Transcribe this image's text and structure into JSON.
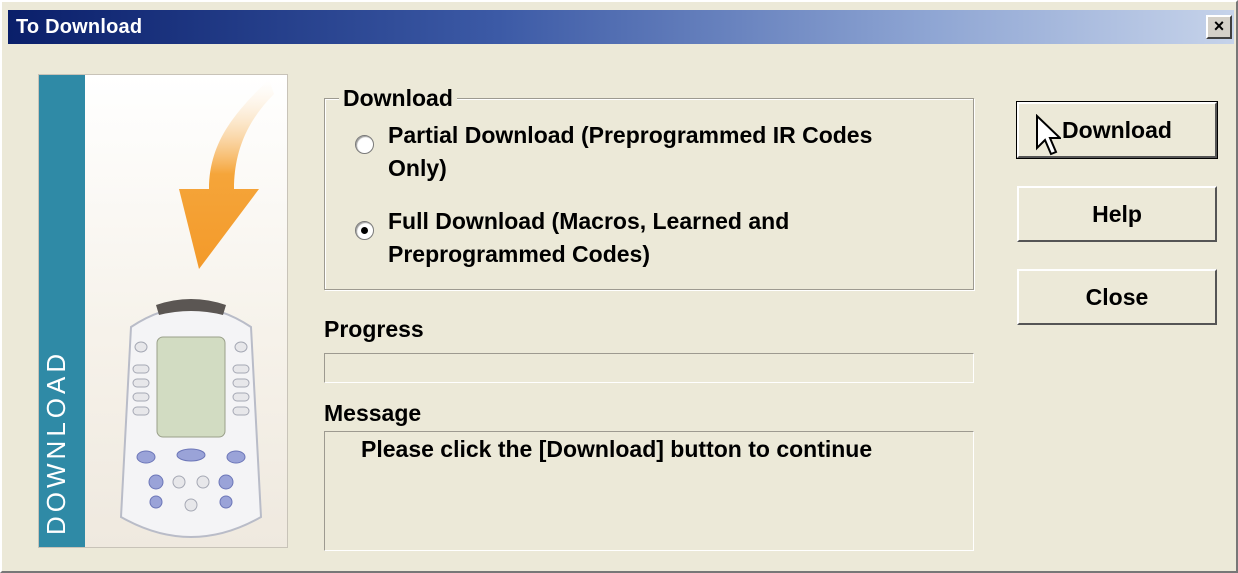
{
  "window": {
    "title": "To Download",
    "close_label": "×"
  },
  "banner": {
    "text": "DOWNLOAD",
    "strip_color": "#2f8aa6",
    "arrow_color": "#f5a53a"
  },
  "download_group": {
    "label": "Download",
    "options": [
      {
        "label": "Partial Download (Preprogrammed IR Codes Only)",
        "checked": false
      },
      {
        "label": "Full Download (Macros, Learned and Preprogrammed Codes)",
        "checked": true
      }
    ]
  },
  "progress": {
    "label": "Progress",
    "value": 0
  },
  "message": {
    "label": "Message",
    "text": "Please click the [Download] button to continue"
  },
  "buttons": {
    "download": "Download",
    "help": "Help",
    "close": "Close"
  },
  "icons": {
    "cursor": "mouse-pointer-icon",
    "arrow": "download-arrow-icon",
    "remote": "remote-control-icon"
  }
}
